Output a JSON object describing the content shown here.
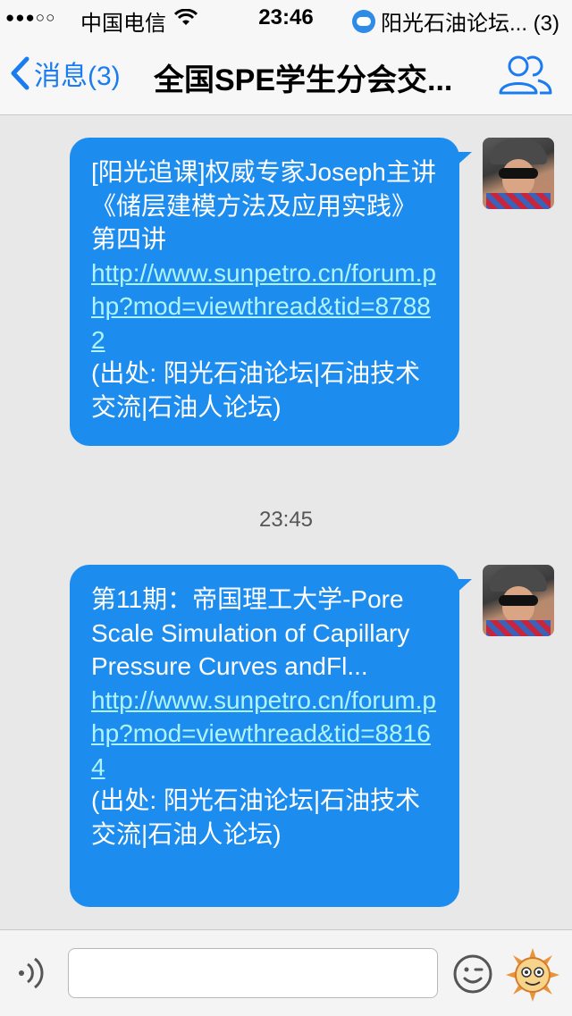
{
  "status_bar": {
    "signal": "●●●○○",
    "carrier": "中国电信",
    "time": "23:46",
    "notification": "阳光石油论坛... (3)"
  },
  "nav": {
    "back_label": "消息(3)",
    "title": "全国SPE学生分会交..."
  },
  "messages": [
    {
      "text": "[阳光追课]权威专家Joseph主讲《储层建模方法及应用实践》第四讲",
      "link": "http://www.sunpetro.cn/forum.php?mod=viewthread&tid=87882",
      "source": "(出处: 阳光石油论坛|石油技术交流|石油人论坛)"
    },
    {
      "text": "第11期：帝国理工大学-Pore Scale Simulation of Capillary Pressure Curves andFl...",
      "link": "http://www.sunpetro.cn/forum.php?mod=viewthread&tid=88164",
      "source": "(出处: 阳光石油论坛|石油技术交流|石油人论坛)"
    }
  ],
  "timestamp": "23:45",
  "input": {
    "placeholder": ""
  },
  "colors": {
    "bubble": "#1d8cef",
    "link": "#aef4fb",
    "accent": "#1a7cf0"
  }
}
